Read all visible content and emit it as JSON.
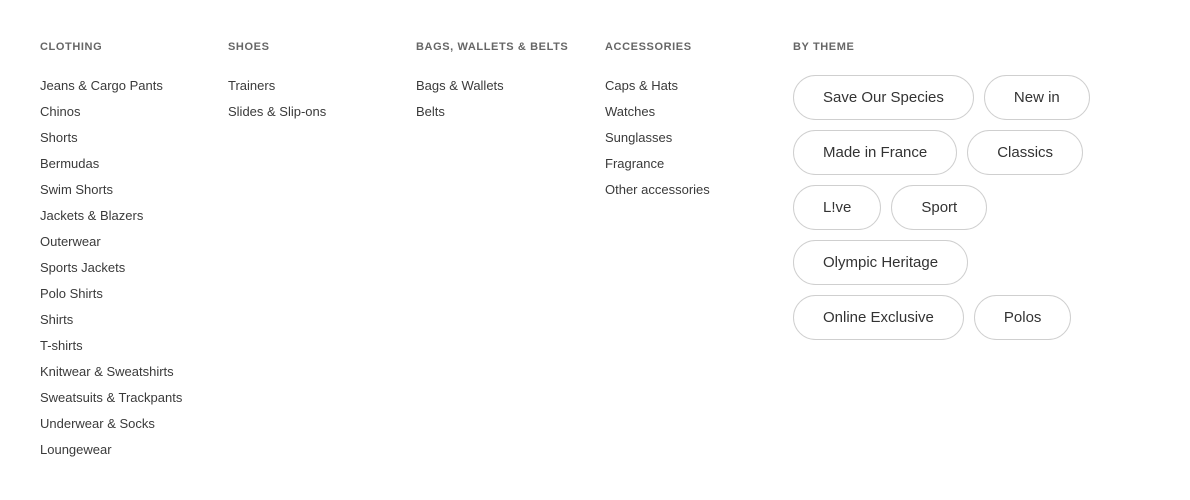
{
  "clothing": {
    "title": "CLOTHING",
    "items": [
      "Jeans & Cargo Pants",
      "Chinos",
      "Shorts",
      "Bermudas",
      "Swim Shorts",
      "Jackets & Blazers",
      "Outerwear",
      "Sports Jackets",
      "Polo Shirts",
      "Shirts",
      "T-shirts",
      "Knitwear & Sweatshirts",
      "Sweatsuits & Trackpants",
      "Underwear & Socks",
      "Loungewear"
    ]
  },
  "shoes": {
    "title": "SHOES",
    "items": [
      "Trainers",
      "Slides & Slip-ons"
    ]
  },
  "bags": {
    "title": "BAGS, WALLETS & BELTS",
    "items": [
      "Bags & Wallets",
      "Belts"
    ]
  },
  "accessories": {
    "title": "ACCESSORIES",
    "items": [
      "Caps & Hats",
      "Watches",
      "Sunglasses",
      "Fragrance",
      "Other accessories"
    ]
  },
  "themes": {
    "title": "BY THEME",
    "rows": [
      [
        "Save Our Species",
        "New in"
      ],
      [
        "Made in France",
        "Classics"
      ],
      [
        "L!ve",
        "Sport"
      ],
      [
        "Olympic Heritage"
      ],
      [
        "Online Exclusive",
        "Polos"
      ]
    ]
  }
}
